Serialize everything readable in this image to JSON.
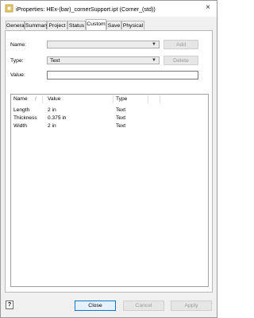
{
  "window": {
    "title": "iProperties: HEx-(bar)_cornerSupport.ipt (Corner_(std))",
    "close_glyph": "×"
  },
  "tabs": [
    {
      "label": "General"
    },
    {
      "label": "Summary"
    },
    {
      "label": "Project"
    },
    {
      "label": "Status"
    },
    {
      "label": "Custom",
      "active": true
    },
    {
      "label": "Save"
    },
    {
      "label": "Physical"
    }
  ],
  "form": {
    "name_label": "Name:",
    "name_value": "",
    "add_label": "Add",
    "type_label": "Type:",
    "type_value": "Text",
    "delete_label": "Delete",
    "value_label": "Value:",
    "value_value": ""
  },
  "table": {
    "headers": [
      "Name",
      "Value",
      "Type"
    ],
    "sort_glyph": "/",
    "rows": [
      {
        "name": "Length",
        "value": "2 in",
        "type": "Text"
      },
      {
        "name": "Thickness",
        "value": "0.375 in",
        "type": "Text"
      },
      {
        "name": "Width",
        "value": "2 in",
        "type": "Text"
      }
    ]
  },
  "footer": {
    "help_glyph": "?",
    "close_label": "Close",
    "cancel_label": "Cancel",
    "apply_label": "Apply"
  },
  "colors": {
    "accent": "#0078d7",
    "disabled_text": "#9a9a9a"
  },
  "icons": {
    "app": "inventor-part-icon",
    "close": "close-icon",
    "dropdown": "chevron-down-icon",
    "help": "help-icon"
  }
}
